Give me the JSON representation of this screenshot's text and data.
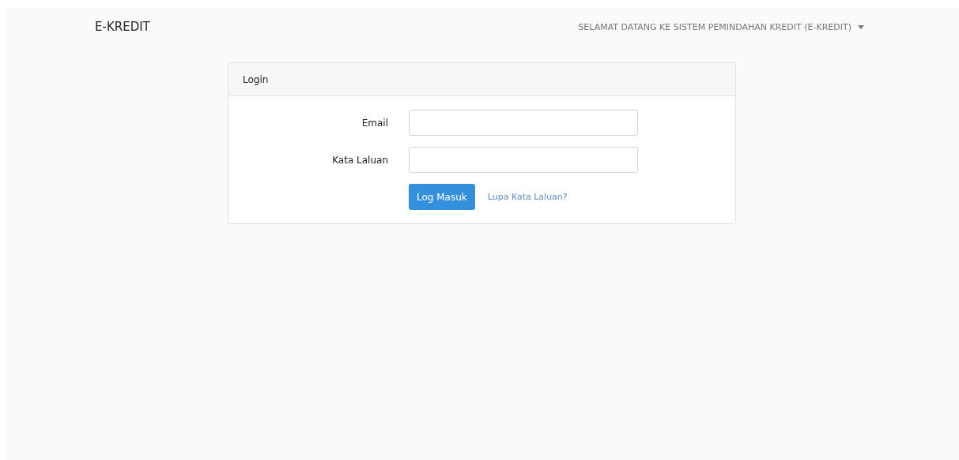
{
  "navbar": {
    "brand": "E-KREDIT",
    "user_menu": "SELAMAT DATANG KE SISTEM PEMINDAHAN KREDIT (E-KREDIT)"
  },
  "card": {
    "title": "Login",
    "fields": [
      {
        "label": "Email"
      },
      {
        "label": "Kata Laluan"
      }
    ],
    "submit": "Log Masuk",
    "forgot_link": "Lupa Kata Laluan?"
  }
}
